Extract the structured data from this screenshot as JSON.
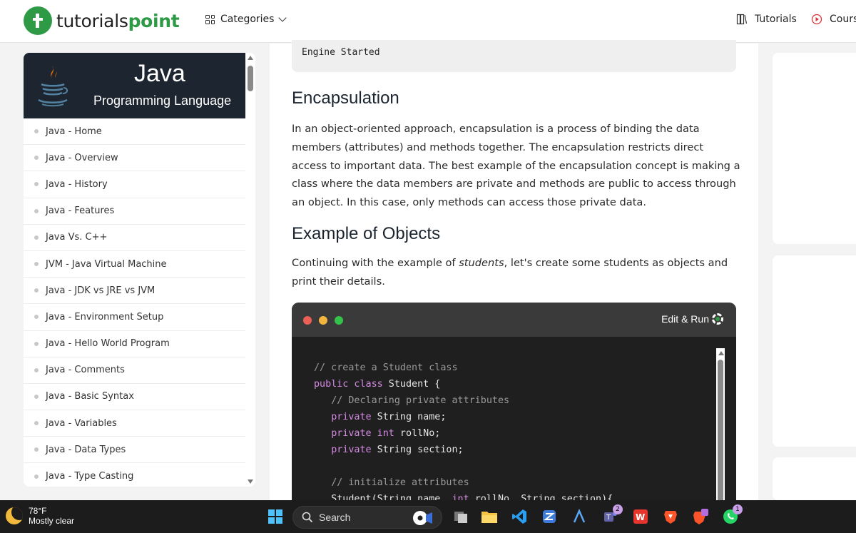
{
  "header": {
    "logo_text_a": "tutorials",
    "logo_text_b": "point",
    "categories_label": "Categories",
    "tutorials_label": "Tutorials",
    "courses_label": "Cours"
  },
  "sidebar": {
    "banner_title": "Java",
    "banner_subtitle": "Programming Language",
    "items": [
      {
        "label": "Java - Home"
      },
      {
        "label": "Java - Overview"
      },
      {
        "label": "Java - History"
      },
      {
        "label": "Java - Features"
      },
      {
        "label": "Java Vs. C++"
      },
      {
        "label": "JVM - Java Virtual Machine"
      },
      {
        "label": "Java - JDK vs JRE vs JVM"
      },
      {
        "label": "Java - Environment Setup"
      },
      {
        "label": "Java - Hello World Program"
      },
      {
        "label": "Java - Comments"
      },
      {
        "label": "Java - Basic Syntax"
      },
      {
        "label": "Java - Variables"
      },
      {
        "label": "Java - Data Types"
      },
      {
        "label": "Java - Type Casting"
      }
    ]
  },
  "main": {
    "output_text": "Engine Started",
    "encapsulation_heading": "Encapsulation",
    "encapsulation_text": "In an object-oriented approach, encapsulation is a process of binding the data members (attributes) and methods together. The encapsulation restricts direct access to important data. The best example of the encapsulation concept is making a class where the data members are private and methods are public to access through an object. In this case, only methods can access those private data.",
    "objects_heading": "Example of Objects",
    "objects_text_before": "Continuing with the example of ",
    "objects_text_em": "students",
    "objects_text_after": ", let's create some students as objects and print their details.",
    "edit_run_label": "Edit & Run",
    "code_lines": [
      "// create a Student class",
      "public class Student {",
      "   // Declaring private attributes",
      "   private String name;",
      "   private int rollNo;",
      "   private String section;",
      "",
      "   // initialize attributes",
      "   Student(String name, int rollNo, String section){"
    ]
  },
  "taskbar": {
    "temperature": "78°F",
    "condition": "Mostly clear",
    "search_label": "Search",
    "teams_badge": "2",
    "whatsapp_badge": "1"
  },
  "colors": {
    "brand_green": "#2e9a46",
    "banner_bg": "#1d2530",
    "code_bg": "#1f1f1f",
    "code_keyword": "#d48ae2",
    "code_comment": "#9a9a9a"
  }
}
